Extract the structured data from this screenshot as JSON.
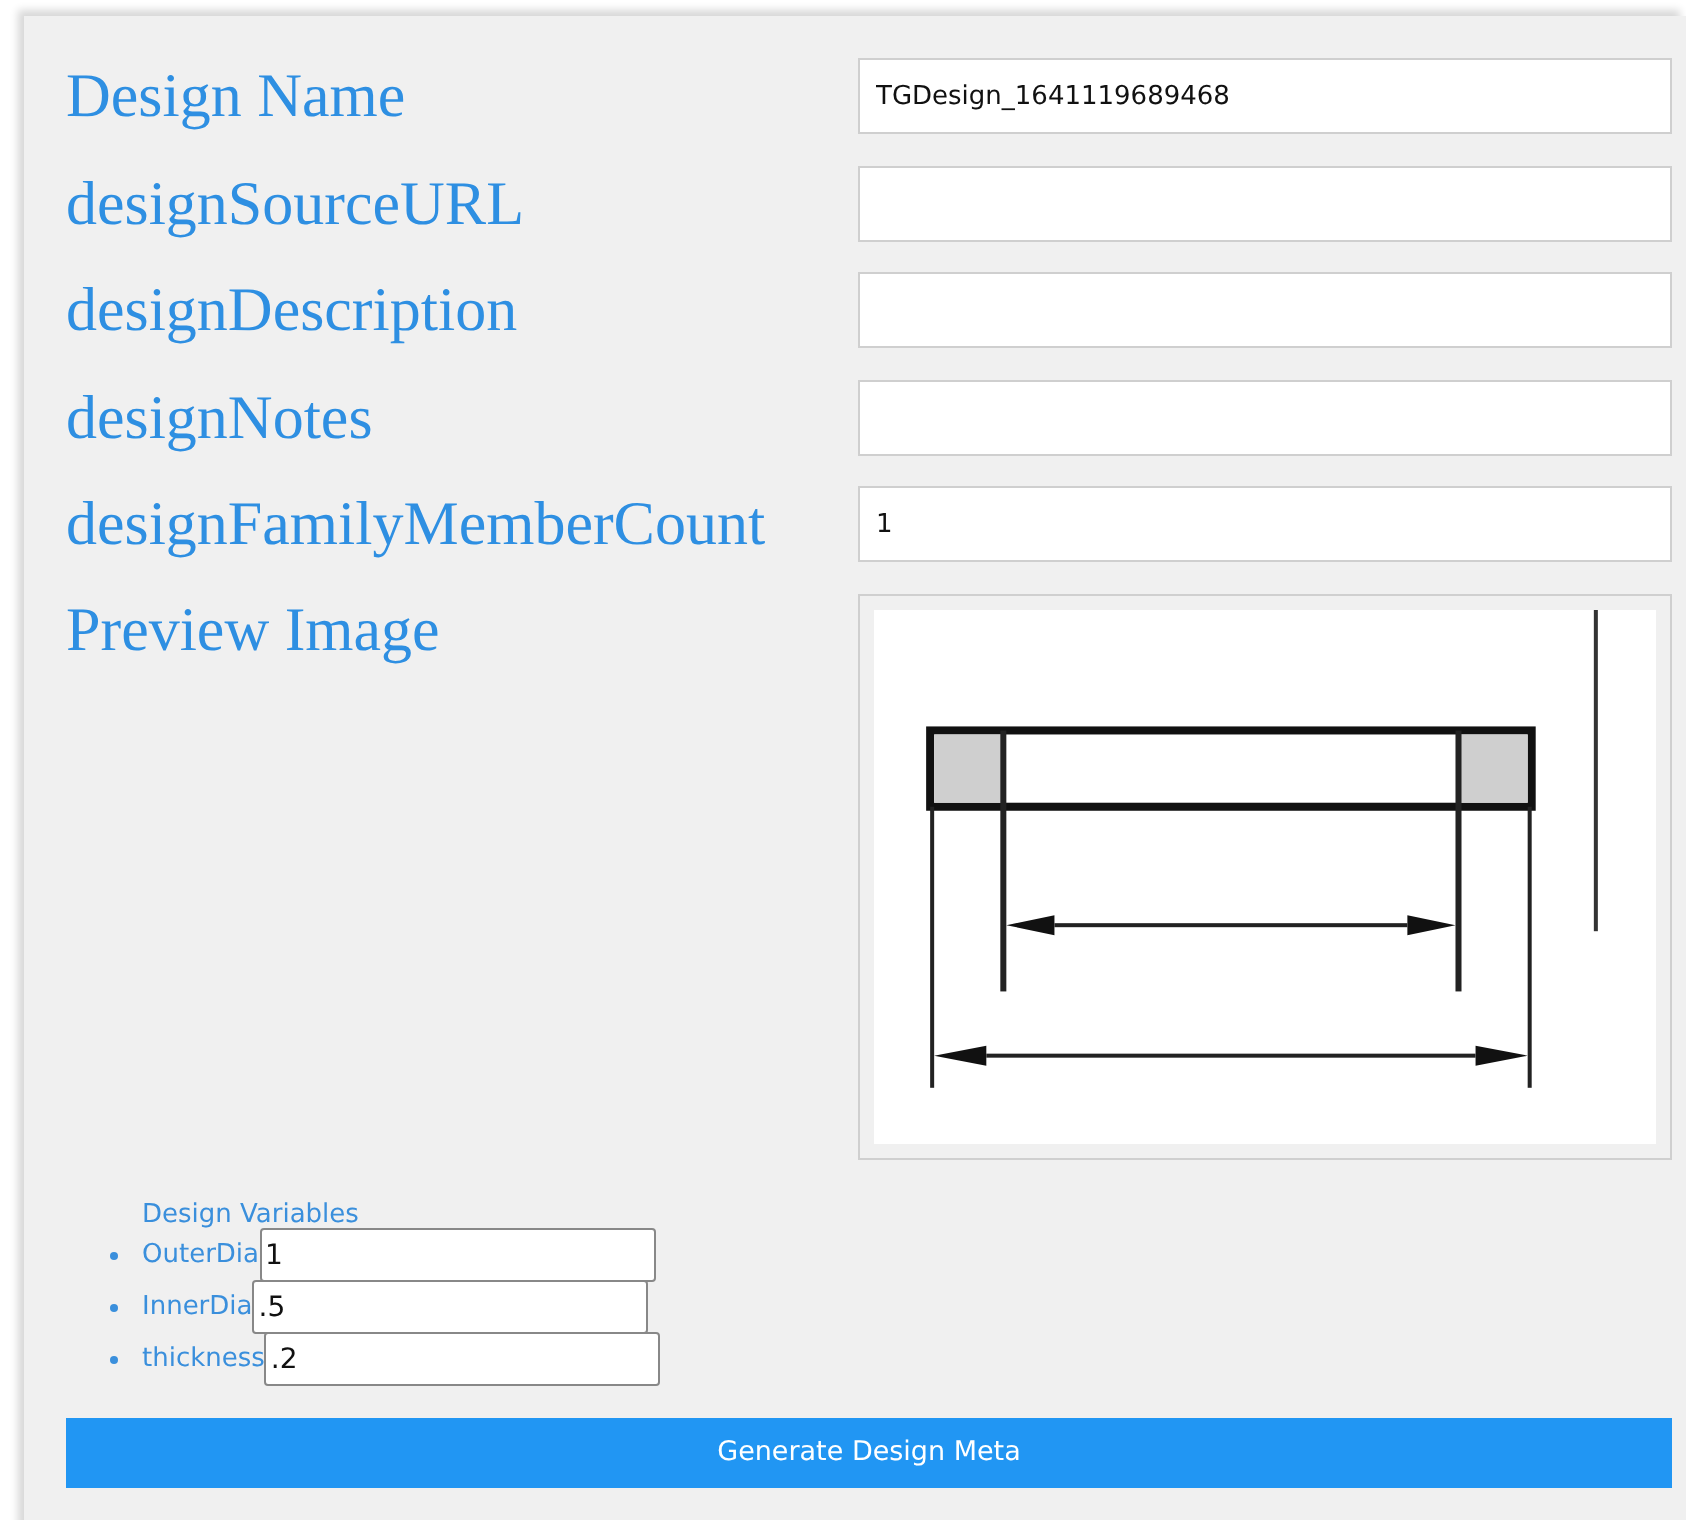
{
  "fields": [
    {
      "label": "Design Name",
      "value": "TGDesign_1641119689468"
    },
    {
      "label": "designSourceURL"
    },
    {
      "label": "designDescription"
    },
    {
      "label": "designNotes"
    },
    {
      "label": "designFamilyMemberCount",
      "value": "1"
    }
  ],
  "preview": {
    "label": "Preview Image"
  },
  "variables": {
    "title": "Design Variables",
    "items": [
      {
        "name": "OuterDia",
        "value": "1"
      },
      {
        "name": "InnerDia",
        "value": ".5"
      },
      {
        "name": "thickness",
        "value": ".2"
      }
    ]
  },
  "button": "Generate Design Meta"
}
